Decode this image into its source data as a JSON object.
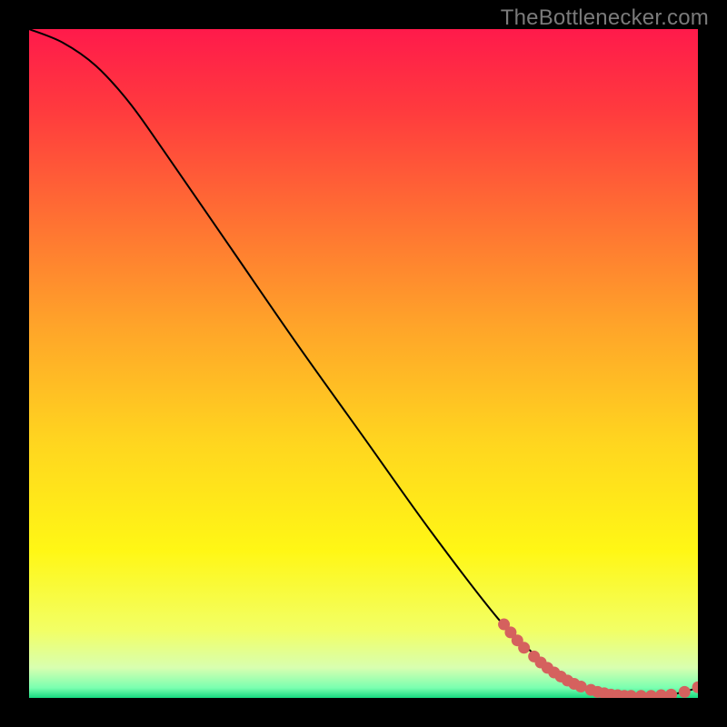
{
  "watermark": "TheBottlenecker.com",
  "chart_data": {
    "type": "line",
    "title": "",
    "xlabel": "",
    "ylabel": "",
    "xlim": [
      0,
      100
    ],
    "ylim": [
      0,
      100
    ],
    "curve": [
      {
        "x": 0,
        "y": 100
      },
      {
        "x": 5,
        "y": 98
      },
      {
        "x": 10,
        "y": 94.5
      },
      {
        "x": 15,
        "y": 89
      },
      {
        "x": 20,
        "y": 82
      },
      {
        "x": 30,
        "y": 67.5
      },
      {
        "x": 40,
        "y": 53
      },
      {
        "x": 50,
        "y": 39
      },
      {
        "x": 60,
        "y": 25
      },
      {
        "x": 70,
        "y": 12
      },
      {
        "x": 75,
        "y": 7
      },
      {
        "x": 80,
        "y": 3
      },
      {
        "x": 85,
        "y": 0.8
      },
      {
        "x": 88,
        "y": 0.3
      },
      {
        "x": 92,
        "y": 0.3
      },
      {
        "x": 96,
        "y": 0.5
      },
      {
        "x": 100,
        "y": 1.5
      }
    ],
    "markers": [
      {
        "x": 71,
        "y": 11.0
      },
      {
        "x": 72,
        "y": 9.8
      },
      {
        "x": 73,
        "y": 8.6
      },
      {
        "x": 74,
        "y": 7.5
      },
      {
        "x": 75.5,
        "y": 6.2
      },
      {
        "x": 76.5,
        "y": 5.3
      },
      {
        "x": 77.5,
        "y": 4.5
      },
      {
        "x": 78.5,
        "y": 3.8
      },
      {
        "x": 79.5,
        "y": 3.2
      },
      {
        "x": 80.5,
        "y": 2.6
      },
      {
        "x": 81.5,
        "y": 2.1
      },
      {
        "x": 82.5,
        "y": 1.7
      },
      {
        "x": 84,
        "y": 1.2
      },
      {
        "x": 85,
        "y": 0.9
      },
      {
        "x": 86,
        "y": 0.7
      },
      {
        "x": 87,
        "y": 0.5
      },
      {
        "x": 88,
        "y": 0.4
      },
      {
        "x": 89,
        "y": 0.3
      },
      {
        "x": 90,
        "y": 0.3
      },
      {
        "x": 91.5,
        "y": 0.3
      },
      {
        "x": 93,
        "y": 0.3
      },
      {
        "x": 94.5,
        "y": 0.4
      },
      {
        "x": 96,
        "y": 0.5
      },
      {
        "x": 98,
        "y": 0.9
      },
      {
        "x": 100,
        "y": 1.6
      }
    ],
    "gradient_stops": [
      {
        "offset": 0.0,
        "color": "#ff1a4b"
      },
      {
        "offset": 0.12,
        "color": "#ff3a3e"
      },
      {
        "offset": 0.28,
        "color": "#ff6f33"
      },
      {
        "offset": 0.45,
        "color": "#ffa629"
      },
      {
        "offset": 0.62,
        "color": "#ffd61f"
      },
      {
        "offset": 0.78,
        "color": "#fff715"
      },
      {
        "offset": 0.9,
        "color": "#f2ff66"
      },
      {
        "offset": 0.955,
        "color": "#d8ffb0"
      },
      {
        "offset": 0.985,
        "color": "#7affb0"
      },
      {
        "offset": 1.0,
        "color": "#17d980"
      }
    ],
    "marker_color": "#d5615e",
    "line_color": "#000000"
  }
}
